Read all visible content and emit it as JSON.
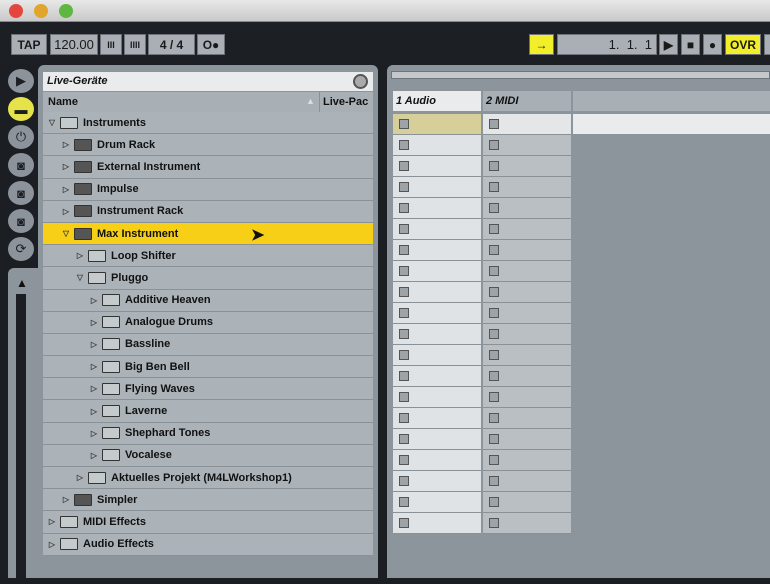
{
  "transport": {
    "tap": "TAP",
    "tempo": "120.00",
    "nudge_down": "III",
    "nudge_up": "IIII",
    "signature": "4 / 4",
    "metronome": "O●",
    "follow": "→",
    "position": "1.  1.  1",
    "play": "▶",
    "stop": "■",
    "record": "●",
    "overdub": "OVR"
  },
  "browser": {
    "title": "Live-Geräte",
    "col_name": "Name",
    "col_livepack": "Live-Pac",
    "items": [
      {
        "label": "Instruments",
        "depth": 0,
        "open": true
      },
      {
        "label": "Drum Rack",
        "depth": 1,
        "device": true
      },
      {
        "label": "External Instrument",
        "depth": 1,
        "device": true
      },
      {
        "label": "Impulse",
        "depth": 1,
        "device": true
      },
      {
        "label": "Instrument Rack",
        "depth": 1,
        "device": true
      },
      {
        "label": "Max Instrument",
        "depth": 1,
        "device": true,
        "open": true,
        "selected": true
      },
      {
        "label": "Loop Shifter",
        "depth": 2
      },
      {
        "label": "Pluggo",
        "depth": 2,
        "open": true
      },
      {
        "label": "Additive Heaven",
        "depth": 3
      },
      {
        "label": "Analogue Drums",
        "depth": 3
      },
      {
        "label": "Bassline",
        "depth": 3
      },
      {
        "label": "Big Ben Bell",
        "depth": 3
      },
      {
        "label": "Flying Waves",
        "depth": 3
      },
      {
        "label": "Laverne",
        "depth": 3
      },
      {
        "label": "Shephard Tones",
        "depth": 3
      },
      {
        "label": "Vocalese",
        "depth": 3
      },
      {
        "label": "Aktuelles Projekt (M4LWorkshop1)",
        "depth": 2
      },
      {
        "label": "Simpler",
        "depth": 1,
        "device": true
      },
      {
        "label": "MIDI Effects",
        "depth": 0
      },
      {
        "label": "Audio Effects",
        "depth": 0
      }
    ]
  },
  "tracks": [
    {
      "name": "1 Audio"
    },
    {
      "name": "2 MIDI"
    }
  ],
  "colors": {
    "selection": "#f7cf16",
    "yellow": "#f2ee2a"
  }
}
